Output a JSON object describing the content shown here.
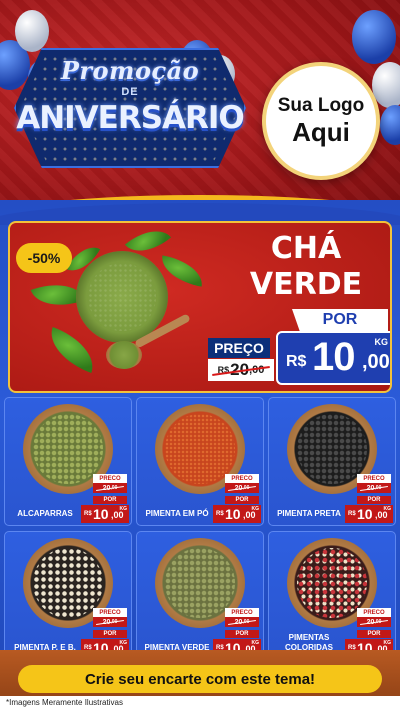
{
  "header": {
    "title_line1": "Promoção",
    "title_line2": "DE",
    "title_line3": "ANIVERSÁRIO",
    "logo_line1": "Sua Logo",
    "logo_line2": "Aqui"
  },
  "hero": {
    "discount": "-50%",
    "name_line1": "CHÁ",
    "name_line2": "VERDE",
    "por_label": "POR",
    "preco_label": "PREÇO",
    "old_currency": "R$",
    "old_int": "20",
    "old_dec": ",00",
    "new_currency": "R$",
    "new_int": "10",
    "new_dec": ",00",
    "unit": "KG"
  },
  "products": [
    {
      "name": "ALCAPARRAS",
      "preco_label": "PRECO",
      "old_int": "20",
      "old_dec": ",00",
      "por_label": "POR",
      "currency": "R$",
      "new_int": "10",
      "new_dec": ",00",
      "unit": "KG"
    },
    {
      "name": "PIMENTA EM PÓ",
      "preco_label": "PRECO",
      "old_int": "20",
      "old_dec": ",00",
      "por_label": "POR",
      "currency": "R$",
      "new_int": "10",
      "new_dec": ",00",
      "unit": "KG"
    },
    {
      "name": "PIMENTA PRETA",
      "preco_label": "PRECO",
      "old_int": "20",
      "old_dec": ",00",
      "por_label": "POR",
      "currency": "R$",
      "new_int": "10",
      "new_dec": ",00",
      "unit": "KG"
    },
    {
      "name": "PIMENTA P. E B.",
      "preco_label": "PRECO",
      "old_int": "20",
      "old_dec": ",00",
      "por_label": "POR",
      "currency": "R$",
      "new_int": "10",
      "new_dec": ",00",
      "unit": "KG"
    },
    {
      "name": "PIMENTA VERDE",
      "preco_label": "PRECO",
      "old_int": "20",
      "old_dec": ",00",
      "por_label": "POR",
      "currency": "R$",
      "new_int": "10",
      "new_dec": ",00",
      "unit": "KG"
    },
    {
      "name": "PIMENTAS COLORIDAS",
      "preco_label": "PRECO",
      "old_int": "20",
      "old_dec": ",00",
      "por_label": "POR",
      "currency": "R$",
      "new_int": "10",
      "new_dec": ",00",
      "unit": "KG"
    }
  ],
  "footer": {
    "cta": "Crie seu encarte com este tema!",
    "disclaimer": "*Imagens Meramente Ilustrativas"
  },
  "colors": {
    "header_red": "#a81812",
    "body_blue": "#2b5bd8",
    "accent_yellow": "#f5c518",
    "price_red": "#c21818"
  }
}
